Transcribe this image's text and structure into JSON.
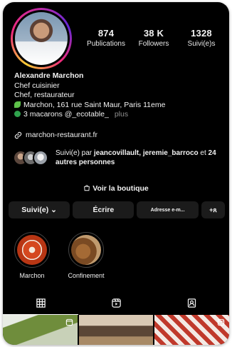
{
  "profile": {
    "name": "Alexandre Marchon",
    "bio_lines": [
      "Chef cuisinier",
      "Chef, restaurateur"
    ],
    "address": "Marchon, 161 rue Saint Maur, Paris 11eme",
    "award": "3 macarons @_ecotable_",
    "more": "plus",
    "link": "marchon-restaurant.fr"
  },
  "stats": [
    {
      "value": "874",
      "label": "Publications"
    },
    {
      "value": "38 K",
      "label": "Followers"
    },
    {
      "value": "1328",
      "label": "Suivi(e)s"
    }
  ],
  "followed_by": {
    "prefix": "Suivi(e) par ",
    "names": "jeancovillault, jeremie_barroco",
    "joiner": " et ",
    "others": "24 autres personnes"
  },
  "shop": {
    "label": "Voir la boutique",
    "icon": "shop-icon"
  },
  "buttons": {
    "following": "Suivi(e) ⌄",
    "message": "Écrire",
    "email": "Adresse e-m...",
    "add_person": "+ጸ"
  },
  "highlights": [
    {
      "label": "Marchon"
    },
    {
      "label": "Confinement"
    }
  ],
  "tabs": [
    {
      "icon": "grid-icon",
      "active": true
    },
    {
      "icon": "reels-icon",
      "active": false
    },
    {
      "icon": "tagged-icon",
      "active": false
    }
  ],
  "colors": {
    "background": "#000000",
    "button_bg": "#1b1b1b",
    "text": "#f2f2f2",
    "muted": "#8e8e8e"
  }
}
